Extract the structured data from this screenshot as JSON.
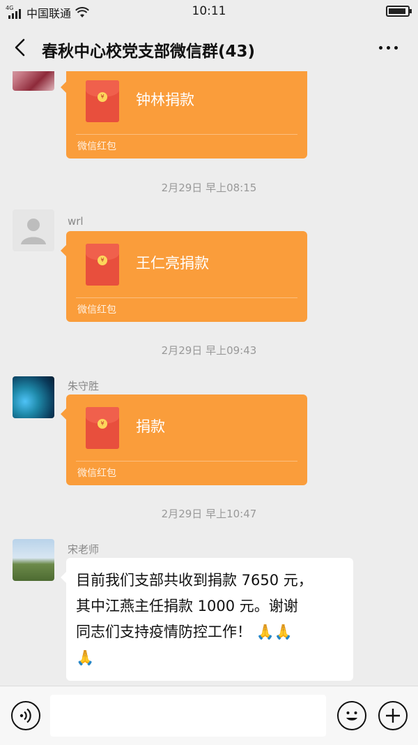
{
  "status_bar": {
    "network": "4G",
    "carrier": "中国联通",
    "time": "10:11"
  },
  "header": {
    "title": "春秋中心校党支部微信群(43)"
  },
  "messages": [
    {
      "type": "red_packet",
      "title": "钟林捐款",
      "label": "微信红包",
      "avatar": "flowers-avatar"
    },
    {
      "type": "timestamp",
      "text": "2月29日 早上08:15"
    },
    {
      "type": "red_packet",
      "sender": "wrl",
      "title": "王仁亮捐款",
      "label": "微信红包",
      "avatar": "default-avatar"
    },
    {
      "type": "timestamp",
      "text": "2月29日 早上09:43"
    },
    {
      "type": "red_packet",
      "sender": "朱守胜",
      "title": "捐款",
      "label": "微信红包",
      "avatar": "ocean-avatar"
    },
    {
      "type": "timestamp",
      "text": "2月29日 早上10:47"
    },
    {
      "type": "text",
      "sender": "宋老师",
      "lines": [
        "目前我们支部共收到捐款 7650 元，",
        "其中江燕主任捐款 1000 元。谢谢",
        "同志们支持疫情防控工作！ 🙏🙏",
        "🙏"
      ],
      "avatar": "photo-avatar"
    }
  ],
  "input_bar": {
    "placeholder": ""
  },
  "colors": {
    "red_packet": "#fa9d3b",
    "envelope": "#e84f3d",
    "background": "#ededed"
  }
}
